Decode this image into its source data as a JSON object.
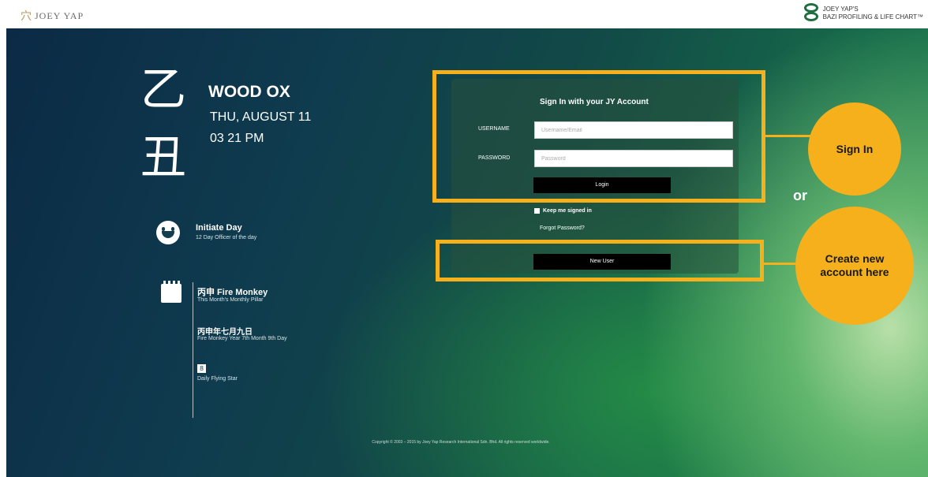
{
  "header": {
    "brand_left_mark": "⽳",
    "brand_left_text": "JOEY YAP",
    "brand_right_line1": "JOEY YAP'S",
    "brand_right_line2": "BAZI PROFILING & LIFE CHART™"
  },
  "day": {
    "glyph_stem": "乙",
    "glyph_branch": "丑",
    "element_title": "WOOD OX",
    "date": "THU, AUGUST 11",
    "time": "03  21 PM"
  },
  "officer": {
    "title": "Initiate Day",
    "subtitle": "12 Day Officer of the day"
  },
  "calendar_info": {
    "monthly_title": "丙申 Fire Monkey",
    "monthly_sub": "This Month's Monthly Pillar",
    "year_title": "丙申年七月九日",
    "year_sub": "Fire Monkey Year 7th Month 9th Day",
    "star_number": "8",
    "star_label": "Daily Flying Star"
  },
  "login": {
    "heading": "Sign In with your JY Account",
    "username_label": "USERNAME",
    "username_placeholder": "Username/Email",
    "password_label": "PASSWORD",
    "password_placeholder": "Password",
    "login_button": "Login",
    "keep_signed_in": "Keep me signed in",
    "forgot_password": "Forgot Password?",
    "new_user_button": "New User"
  },
  "callouts": {
    "sign_in": "Sign In",
    "or": "or",
    "create_account": "Create new account here",
    "accent_color": "#f5b01b"
  },
  "footer": {
    "copyright": "Copyright © 2003 – 2015 by Joey Yap Research International Sdn. Bhd. All rights reserved worldwide."
  }
}
